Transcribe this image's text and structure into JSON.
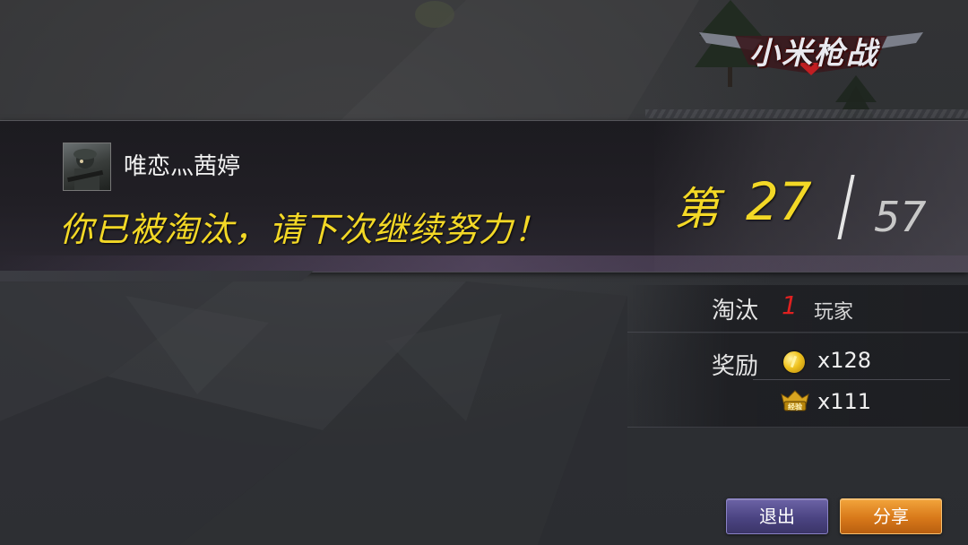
{
  "game": {
    "logo_text": "小米枪战"
  },
  "result": {
    "player_name": "唯恋灬茜婷",
    "message": "你已被淘汰，请下次继续努力！",
    "rank_prefix": "第",
    "rank": "27",
    "total": "57"
  },
  "stats": {
    "elim_label": "淘汰",
    "elim_count": "1",
    "elim_unit": "玩家",
    "reward_label": "奖励",
    "coins": "x128",
    "exp": "x111",
    "exp_badge_text": "经验"
  },
  "buttons": {
    "exit_label": "退出",
    "share_label": "分享"
  },
  "colors": {
    "highlight_yellow": "#f3d826",
    "kill_red": "#e02020",
    "exit_button": "#4b4482",
    "share_button": "#d8791a"
  },
  "icons": {
    "coin": "gold-coin-icon",
    "exp": "exp-badge-icon"
  }
}
